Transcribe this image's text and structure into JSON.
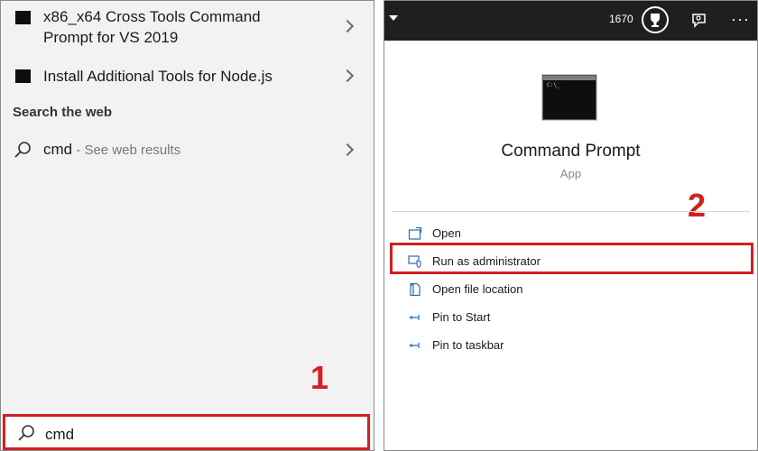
{
  "left_panel": {
    "results": [
      {
        "line1": "x86_x64 Cross Tools Command",
        "line2": "Prompt for VS 2019"
      },
      {
        "line1": "Install Additional Tools for Node.js",
        "line2": ""
      }
    ],
    "section_title": "Search the web",
    "web_result": {
      "query": "cmd",
      "suffix": " - See web results"
    },
    "search_input_value": "cmd",
    "step_marker": "1"
  },
  "right_panel": {
    "points": "1670",
    "app_name": "Command Prompt",
    "app_type": "App",
    "step_marker": "2",
    "actions": [
      {
        "label": "Open",
        "icon": "open-icon"
      },
      {
        "label": "Run as administrator",
        "icon": "shield-admin-icon"
      },
      {
        "label": "Open file location",
        "icon": "file-location-icon"
      },
      {
        "label": "Pin to Start",
        "icon": "pin-icon"
      },
      {
        "label": "Pin to taskbar",
        "icon": "pin-icon"
      }
    ]
  },
  "colors": {
    "highlight": "#d0201f",
    "topbar": "#1f1f1f",
    "panel_bg": "#f2f2f2",
    "icon_blue": "#2b6cb0"
  }
}
